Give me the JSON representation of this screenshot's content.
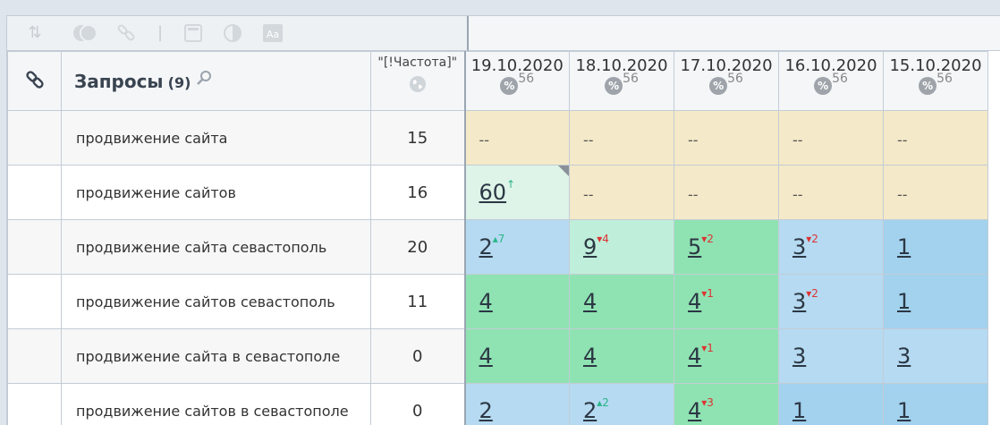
{
  "header": {
    "query_title": "Запросы",
    "query_count": "(9)",
    "freq_title": "\"[!Частота]\"",
    "dates": [
      "19.10.2020",
      "18.10.2020",
      "17.10.2020",
      "16.10.2020",
      "15.10.2020"
    ],
    "percent_symbol": "%",
    "percent_value": "56"
  },
  "rows": [
    {
      "query": "продвижение сайта",
      "freq": "15",
      "cells": [
        {
          "v": "--"
        },
        {
          "v": "--"
        },
        {
          "v": "--"
        },
        {
          "v": "--"
        },
        {
          "v": "--"
        }
      ]
    },
    {
      "query": "продвижение сайтов",
      "freq": "16",
      "cells": [
        {
          "v": "60",
          "ch": "↑",
          "dir": "up"
        },
        {
          "v": "--"
        },
        {
          "v": "--"
        },
        {
          "v": "--"
        },
        {
          "v": "--"
        }
      ]
    },
    {
      "query": "продвижение сайта севастополь",
      "freq": "20",
      "cells": [
        {
          "v": "2",
          "ch": "▴7",
          "dir": "up"
        },
        {
          "v": "9",
          "ch": "▾4",
          "dir": "down"
        },
        {
          "v": "5",
          "ch": "▾2",
          "dir": "down"
        },
        {
          "v": "3",
          "ch": "▾2",
          "dir": "down"
        },
        {
          "v": "1"
        }
      ]
    },
    {
      "query": "продвижение сайтов севастополь",
      "freq": "11",
      "cells": [
        {
          "v": "4"
        },
        {
          "v": "4"
        },
        {
          "v": "4",
          "ch": "▾1",
          "dir": "down"
        },
        {
          "v": "3",
          "ch": "▾2",
          "dir": "down"
        },
        {
          "v": "1"
        }
      ]
    },
    {
      "query": "продвижение сайта в севастополе",
      "freq": "0",
      "cells": [
        {
          "v": "4"
        },
        {
          "v": "4"
        },
        {
          "v": "4",
          "ch": "▾1",
          "dir": "down"
        },
        {
          "v": "3"
        },
        {
          "v": "3"
        }
      ]
    },
    {
      "query": "продвижение сайтов в севастополе",
      "freq": "0",
      "cells": [
        {
          "v": "2"
        },
        {
          "v": "2",
          "ch": "▴2",
          "dir": "up"
        },
        {
          "v": "4",
          "ch": "▾3",
          "dir": "down"
        },
        {
          "v": "1"
        },
        {
          "v": "1"
        }
      ]
    }
  ],
  "colors": {
    "no_data": "#f4e9c8",
    "new": "#def4e8",
    "green_light": "#bfeeda",
    "green": "#8fe3b2",
    "blue_light": "#b5daf1",
    "blue": "#a2d2ee",
    "up": "#2bb58a",
    "down": "#dd3333"
  },
  "icons": [
    "sort-icon",
    "toggle-icon",
    "link-icon",
    "calendar-icon",
    "contrast-icon",
    "font-icon",
    "chain-link-icon",
    "search-icon",
    "globe-icon",
    "percent-icon"
  ]
}
